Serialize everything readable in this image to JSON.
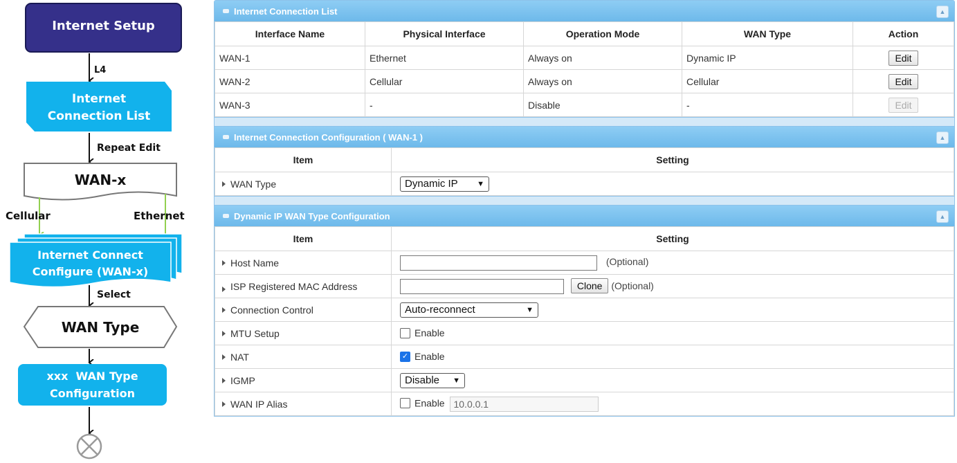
{
  "flowchart": {
    "internet_setup": "Internet Setup",
    "l4": "L4",
    "connection_list_line1": "Internet",
    "connection_list_line2": "Connection List",
    "repeat_edit": "Repeat Edit",
    "wan_x": "WAN-x",
    "cellular": "Cellular",
    "ethernet": "Ethernet",
    "configure_line1": "Internet Connect",
    "configure_line2": "Configure (WAN-x)",
    "select": "Select",
    "wan_type": "WAN Type",
    "type_config_line1": "xxx  WAN Type",
    "type_config_line2": "Configuration",
    "colors": {
      "dark_box": "#35308a",
      "cyan_box": "#12b2ec",
      "green_arrow": "#92d050"
    }
  },
  "connection_list": {
    "title": "Internet Connection List",
    "headers": [
      "Interface Name",
      "Physical Interface",
      "Operation Mode",
      "WAN Type",
      "Action"
    ],
    "rows": [
      {
        "name": "WAN-1",
        "physical": "Ethernet",
        "mode": "Always on",
        "type": "Dynamic IP",
        "action": "Edit"
      },
      {
        "name": "WAN-2",
        "physical": "Cellular",
        "mode": "Always on",
        "type": "Cellular",
        "action": "Edit"
      },
      {
        "name": "WAN-3",
        "physical": "-",
        "mode": "Disable",
        "type": "-",
        "action": "Edit"
      }
    ]
  },
  "connection_config": {
    "title": "Internet Connection Configuration ( WAN-1 )",
    "headers": [
      "Item",
      "Setting"
    ],
    "wan_type_label": "WAN Type",
    "wan_type_value": "Dynamic IP"
  },
  "dynamic_ip": {
    "title": "Dynamic IP WAN Type Configuration",
    "headers": [
      "Item",
      "Setting"
    ],
    "host_name_label": "Host Name",
    "host_name_value": "",
    "optional": "(Optional)",
    "mac_label": "ISP Registered MAC Address",
    "mac_value": "",
    "clone_label": "Clone",
    "connection_control_label": "Connection Control",
    "connection_control_value": "Auto-reconnect",
    "mtu_label": "MTU Setup",
    "mtu_enable": "Enable",
    "nat_label": "NAT",
    "nat_enable": "Enable",
    "igmp_label": "IGMP",
    "igmp_value": "Disable",
    "alias_label": "WAN IP Alias",
    "alias_enable": "Enable",
    "alias_value": "10.0.0.1"
  }
}
